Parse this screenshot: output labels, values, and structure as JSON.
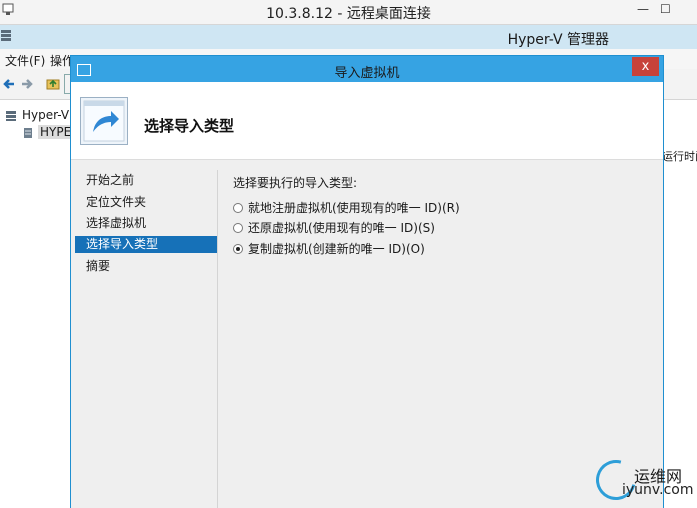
{
  "rdp": {
    "title": "10.3.8.12 - 远程桌面连接",
    "minimize_glyph": "—",
    "restore_glyph": "☐",
    "icon": "remote-desktop-icon"
  },
  "hyperv": {
    "title": "Hyper-V 管理器",
    "menu": [
      "文件(F)",
      "操作"
    ],
    "tree": [
      "Hyper-V",
      "HYPER"
    ],
    "column_header": "运行时间"
  },
  "dialog": {
    "title": "导入虚拟机",
    "close_glyph": "x",
    "header_title": "选择导入类型",
    "nav": [
      {
        "label": "开始之前",
        "active": false
      },
      {
        "label": "定位文件夹",
        "active": false
      },
      {
        "label": "选择虚拟机",
        "active": false
      },
      {
        "label": "选择导入类型",
        "active": true
      },
      {
        "label": "摘要",
        "active": false
      }
    ],
    "prompt": "选择要执行的导入类型:",
    "options": [
      {
        "label": "就地注册虚拟机(使用现有的唯一 ID)(R)",
        "selected": false
      },
      {
        "label": "还原虚拟机(使用现有的唯一 ID)(S)",
        "selected": false
      },
      {
        "label": "复制虚拟机(创建新的唯一 ID)(O)",
        "selected": true
      }
    ]
  },
  "watermark": {
    "cn": "运维网",
    "en": "iyunv.com"
  },
  "colors": {
    "dialog_titlebar": "#36a3e3",
    "selected_nav": "#1671b8",
    "close_button": "#c7423a"
  }
}
